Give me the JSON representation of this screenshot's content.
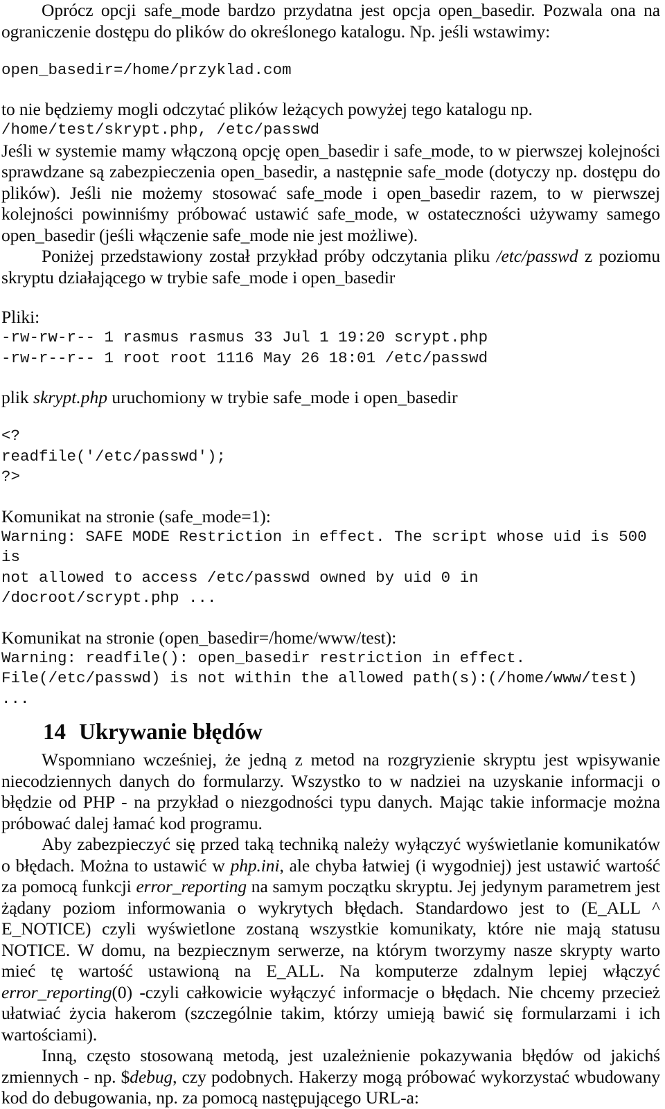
{
  "document": {
    "language": "pl",
    "paragraphs": {
      "p1_part1": "Oprócz opcji safe_mode bardzo przydatna jest opcja open_basedir. Pozwala ona na ograniczenie dostępu do plików do określonego katalogu. Np. jeśli wstawimy:",
      "code_open_basedir": "open_basedir=/home/przyklad.com",
      "p2": "to nie będziemy mogli odczytać plików leżących powyżej tego katalogu np.",
      "code_paths": "/home/test/skrypt.php, /etc/passwd",
      "p3": "Jeśli w systemie mamy włączoną opcję open_basedir i safe_mode, to w pierwszej kolejności sprawdzane są zabezpieczenia open_basedir, a następnie safe_mode (dotyczy np. dostępu do plików). Jeśli nie możemy stosować safe_mode i open_basedir razem, to w pierwszej kolejności powinniśmy próbować ustawić safe_mode, w ostateczności używamy samego open_basedir (jeśli włączenie safe_mode nie jest możliwe).",
      "p4_before_italic": "Poniżej przedstawiony został przykład próby odczytania pliku ",
      "p4_italic": "/etc/passwd",
      "p4_after_italic": " z poziomu skryptu działającego w trybie safe_mode i open_basedir",
      "label_pliki": "Pliki:",
      "file_listing_line1": "-rw-rw-r-- 1 rasmus rasmus 33 Jul 1 19:20 scrypt.php",
      "file_listing_line2": "-rw-r--r-- 1 root root 1116 May 26 18:01 /etc/passwd",
      "caption_before_italic": "plik ",
      "caption_italic": "skrypt.php",
      "caption_after_italic": " uruchomiony w trybie safe_mode i open_basedir",
      "code_php_line1": "<?",
      "code_php_line2": "readfile('/etc/passwd');",
      "code_php_line3": "?>",
      "label_komunikat_safemode": "Komunikat na stronie (safe_mode=1):",
      "warning_safemode_line1": "Warning: SAFE MODE Restriction in effect. The script whose uid is 500 is",
      "warning_safemode_line2": "not allowed to access /etc/passwd owned by uid 0 in /docroot/scrypt.php ...",
      "label_komunikat_openbasedir": "Komunikat na stronie (open_basedir=/home/www/test):",
      "warning_openbasedir_line1": "Warning: readfile(): open_basedir restriction in effect.",
      "warning_openbasedir_line2": "File(/etc/passwd) is not within the allowed path(s):(/home/www/test) ...",
      "p6": "Wspomniano wcześniej, że jedną z metod na rozgryzienie skryptu jest wpisywanie niecodziennych danych do formularzy. Wszystko to w nadziei na uzyskanie informacji o błędzie od PHP - na przykład o niezgodności typu danych. Mając takie informacje można próbować dalej łamać kod programu.",
      "p7_a": "Aby zabezpieczyć się przed taką techniką należy wyłączyć wyświetlanie komunikatów o błędach. Można to ustawić w ",
      "p7_i1": "php.ini",
      "p7_b": ", ale chyba łatwiej (i wygodniej) jest ustawić wartość za pomocą funkcji ",
      "p7_i2": "error_reporting",
      "p7_c": " na samym początku skryptu. Jej jedynym parametrem jest żądany poziom informowania o wykrytych błędach. Standardowo jest to (E_ALL ^ E_NOTICE) czyli wyświetlone zostaną wszystkie komunikaty, które nie mają statusu NOTICE. W domu, na bezpiecznym serwerze, na którym tworzymy nasze skrypty warto mieć tę wartość ustawioną na E_ALL. Na komputerze zdalnym lepiej włączyć ",
      "p7_i3": "error_reporting",
      "p7_d": "(0) -czyli całkowicie wyłączyć informacje o błędach. Nie chcemy przecież ułatwiać życia hakerom (szczególnie takim, którzy umieją bawić się formularzami i ich wartościami).",
      "p8_a": "Inną, często stosowaną metodą, jest uzależnienie pokazywania błędów od jakichś zmiennych - np. $",
      "p8_i1": "debug",
      "p8_b": ", czy podobnych. Hakerzy mogą próbować wykorzystać wbudowany kod do debugowania, np. za pomocą następującego URL-a:"
    },
    "heading": {
      "number": "14",
      "title": "Ukrywanie błędów"
    }
  }
}
